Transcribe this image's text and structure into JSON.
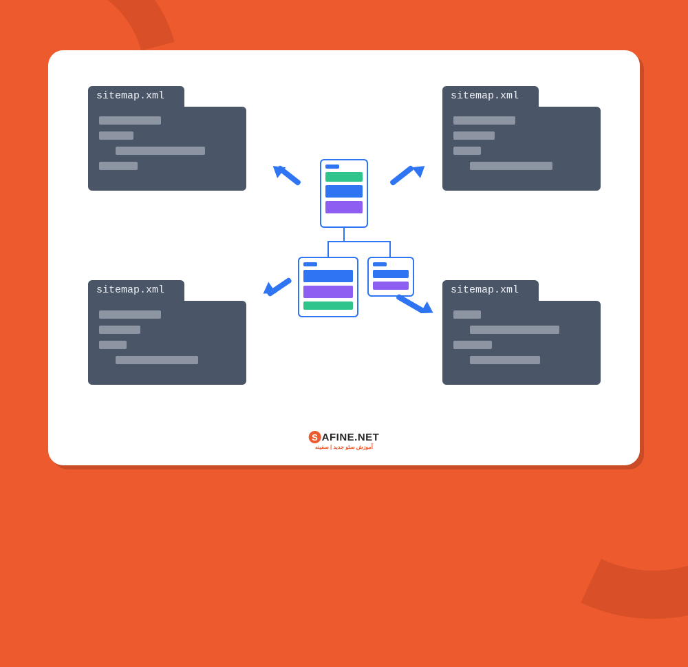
{
  "folders": {
    "tl": {
      "label": "sitemap.xml"
    },
    "tr": {
      "label": "sitemap.xml"
    },
    "bl": {
      "label": "sitemap.xml"
    },
    "br": {
      "label": "sitemap.xml"
    }
  },
  "logo": {
    "brand_s": "S",
    "brand_rest": "AFINE.NET",
    "tagline": "آموزش سئو جدید | سفینه"
  }
}
